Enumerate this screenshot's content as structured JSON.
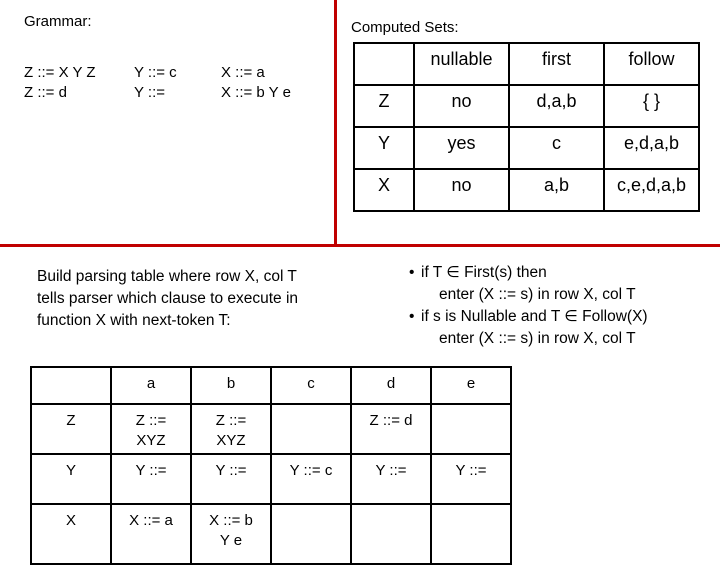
{
  "grammar": {
    "label": "Grammar:",
    "columns": [
      [
        "Z ::= X Y Z",
        "Z ::= d"
      ],
      [
        "Y ::= c",
        "Y ::="
      ],
      [
        "X ::= a",
        "X ::= b Y e"
      ]
    ]
  },
  "computed_sets": {
    "label": "Computed Sets:",
    "headers": [
      "",
      "nullable",
      "first",
      "follow"
    ],
    "rows": [
      [
        "Z",
        "no",
        "d,a,b",
        "{ }"
      ],
      [
        "Y",
        "yes",
        "c",
        "e,d,a,b"
      ],
      [
        "X",
        "no",
        "a,b",
        "c,e,d,a,b"
      ]
    ]
  },
  "description": [
    "Build parsing table where row X, col T",
    "tells parser which clause to execute in",
    "function X with next-token T:"
  ],
  "rules": {
    "bullet": "•",
    "items": [
      {
        "condition": "if T ∈ First(s) then",
        "action": "enter (X ::= s) in row X, col T"
      },
      {
        "condition": "if s is Nullable and T ∈ Follow(X)",
        "action": "enter (X ::= s) in row X, col T"
      }
    ]
  },
  "parse_table": {
    "headers": [
      "",
      "a",
      "b",
      "c",
      "d",
      "e"
    ],
    "rows": [
      [
        "Z",
        "Z ::=\nXYZ",
        "Z ::=\nXYZ",
        "",
        "Z ::= d",
        ""
      ],
      [
        "Y",
        "Y ::=",
        "Y ::=",
        "Y ::= c",
        "Y ::=",
        "Y ::="
      ],
      [
        "X",
        "X ::= a",
        "X ::= b\nY e",
        "",
        "",
        ""
      ]
    ]
  },
  "colors": {
    "divider": "#c00000",
    "border": "#000000",
    "background": "#ffffff"
  }
}
